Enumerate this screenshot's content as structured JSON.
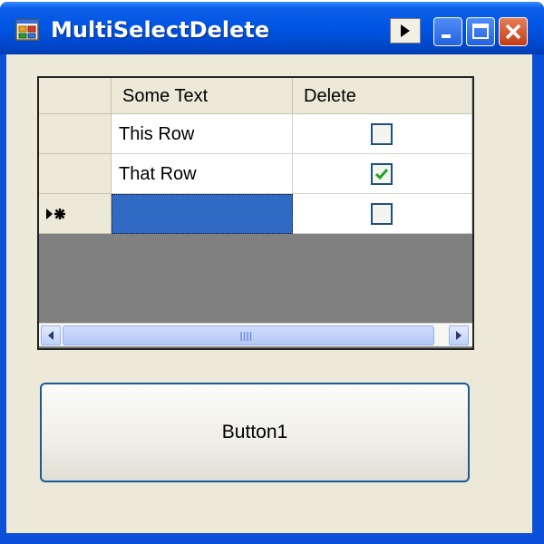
{
  "window": {
    "title": "MultiSelectDelete"
  },
  "titlebar_buttons": {
    "play_icon": "play-icon",
    "minimize_icon": "minimize-icon",
    "maximize_icon": "maximize-icon",
    "close_icon": "close-icon"
  },
  "grid": {
    "columns": [
      "Some Text",
      "Delete"
    ],
    "rows": [
      {
        "text": "This Row",
        "delete": false
      },
      {
        "text": "That Row",
        "delete": true
      },
      {
        "text": "",
        "delete": false,
        "new_row": true
      }
    ],
    "new_row_marker_icon": "new-row-arrow-asterisk-icon"
  },
  "button1": {
    "label": "Button1"
  },
  "colors": {
    "title_bar": "#0054e3",
    "client_background": "#ece9d8",
    "grid_empty_area": "#808080",
    "selected_cell": "#316ac5",
    "close_button": "#d2502a",
    "checkmark": "#21a121"
  }
}
